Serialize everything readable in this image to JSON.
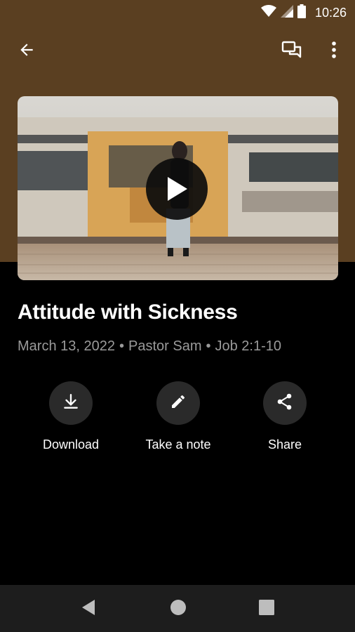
{
  "status_bar": {
    "time": "10:26"
  },
  "app_bar": {
    "back_icon": "arrow-back-icon",
    "chat_icon": "chat-icon",
    "more_icon": "more-vert-icon"
  },
  "video": {
    "play_icon": "play-icon",
    "background_color": "#5a3f21"
  },
  "sermon": {
    "title": "Attitude with Sickness",
    "date": "March 13, 2022",
    "separator_1": "•",
    "speaker": "Pastor Sam",
    "separator_2": "•",
    "passage": "Job 2:1-10"
  },
  "actions": [
    {
      "label": "Download",
      "icon": "download-icon"
    },
    {
      "label": "Take a note",
      "icon": "pencil-icon"
    },
    {
      "label": "Share",
      "icon": "share-icon"
    }
  ],
  "nav_bar": {
    "back_icon": "nav-back-icon",
    "home_icon": "nav-home-icon",
    "recents_icon": "nav-recents-icon"
  }
}
